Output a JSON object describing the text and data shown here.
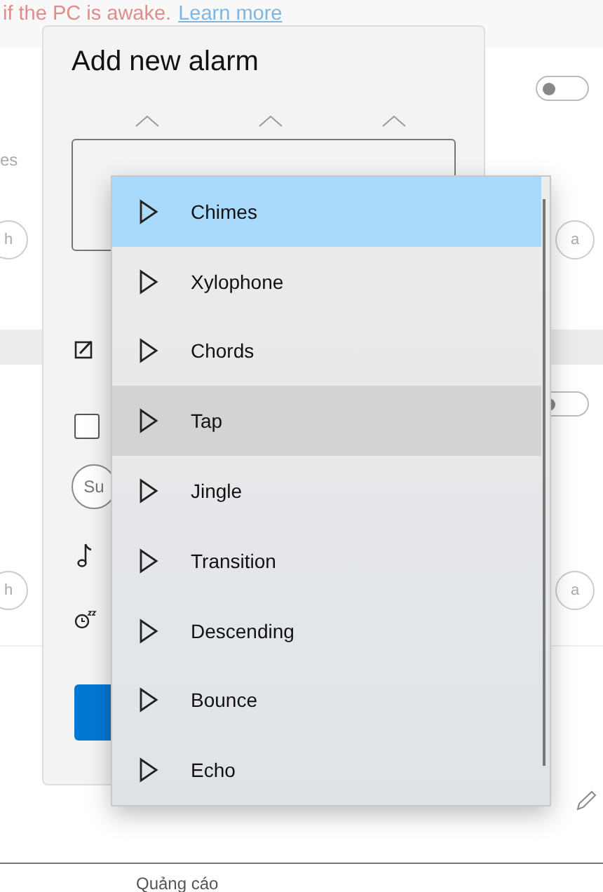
{
  "notice": {
    "text": "if the PC is awake.",
    "link": "Learn more"
  },
  "alarms": [
    {
      "on": false,
      "label": "es",
      "days": [
        {
          "label": "h",
          "selected": false
        },
        {
          "label": "a",
          "selected": false
        }
      ]
    },
    {
      "on": false,
      "days": [
        {
          "label": "h",
          "selected": false
        },
        {
          "label": "a",
          "selected": false
        }
      ]
    }
  ],
  "dialog": {
    "title": "Add new alarm",
    "repeat_checked": false,
    "days": [
      {
        "label": "Su",
        "selected": false
      }
    ]
  },
  "sound_menu": {
    "items": [
      {
        "label": "Chimes",
        "selected": true,
        "hovered": false
      },
      {
        "label": "Xylophone",
        "selected": false,
        "hovered": false
      },
      {
        "label": "Chords",
        "selected": false,
        "hovered": false
      },
      {
        "label": "Tap",
        "selected": false,
        "hovered": true
      },
      {
        "label": "Jingle",
        "selected": false,
        "hovered": false
      },
      {
        "label": "Transition",
        "selected": false,
        "hovered": false
      },
      {
        "label": "Descending",
        "selected": false,
        "hovered": false
      },
      {
        "label": "Bounce",
        "selected": false,
        "hovered": false
      },
      {
        "label": "Echo",
        "selected": false,
        "hovered": false
      }
    ]
  },
  "footer": "Quảng cáo"
}
